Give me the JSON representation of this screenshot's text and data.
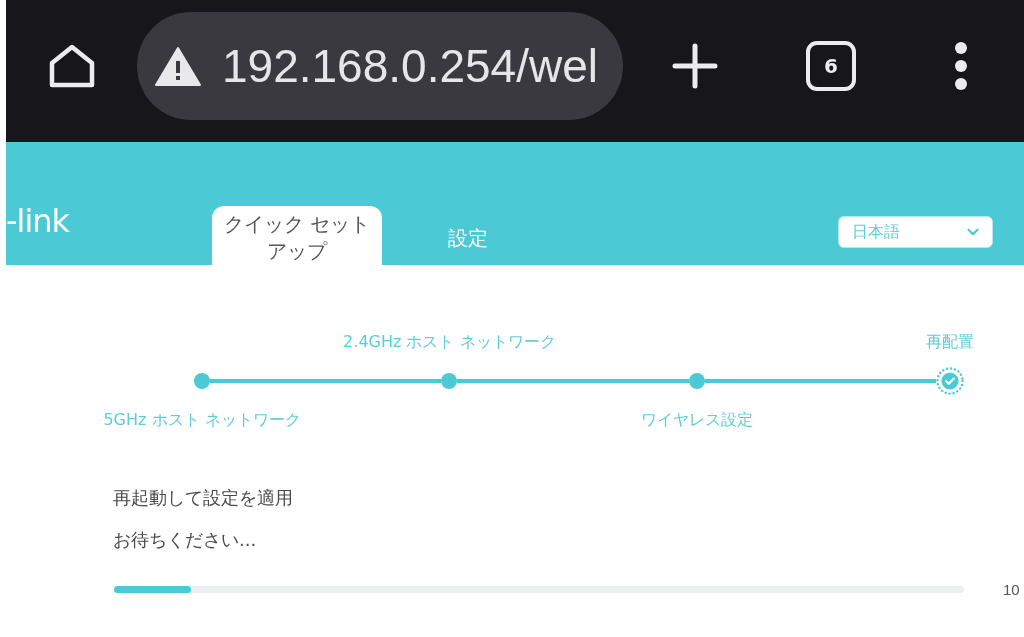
{
  "browser": {
    "url": "192.168.0.254/wel",
    "tab_count": "6"
  },
  "header": {
    "logo": "-link",
    "tabs": [
      {
        "label": "クイック セットアップ",
        "selected": true
      },
      {
        "label": "設定",
        "selected": false
      }
    ],
    "language": {
      "value": "日本語"
    }
  },
  "steps": [
    {
      "label": "5GHz ホスト ネットワーク",
      "kind": "dot"
    },
    {
      "label": "2.4GHz ホスト ネットワーク",
      "kind": "dot"
    },
    {
      "label": "ワイヤレス設定",
      "kind": "dot"
    },
    {
      "label": "再配置",
      "kind": "check"
    }
  ],
  "progress": {
    "title": "再起動して設定を適用",
    "message": "お待ちください...",
    "level": 0.09,
    "reading": "10"
  }
}
